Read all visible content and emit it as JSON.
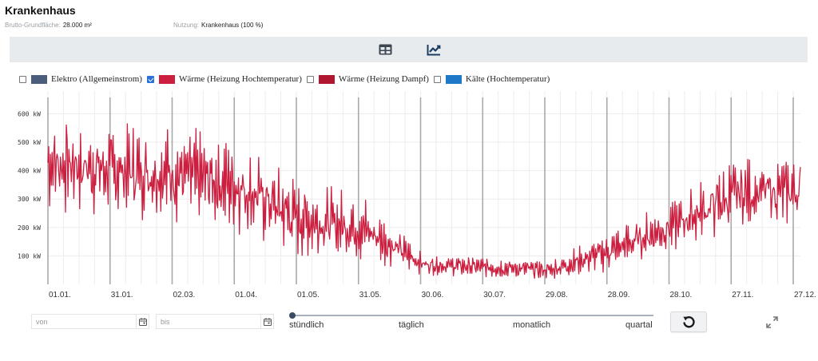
{
  "header": {
    "title": "Krankenhaus",
    "area_label": "Brutto-Grundfläche:",
    "area_value": "28.000 m²",
    "use_label": "Nutzung:",
    "use_value": "Krankenhaus (100 %)"
  },
  "toolbar": {
    "table_icon": "table-icon",
    "chart_icon": "line-chart-icon",
    "active": "chart"
  },
  "legend": [
    {
      "label": "Elektro (Allgemeinstrom)",
      "checked": false,
      "color": "#4a5e7c"
    },
    {
      "label": "Wärme (Heizung Hochtemperatur)",
      "checked": true,
      "color": "#cc1f3f"
    },
    {
      "label": "Wärme (Heizung Dampf)",
      "checked": false,
      "color": "#b0162f"
    },
    {
      "label": "Kälte (Hochtemperatur)",
      "checked": false,
      "color": "#1f78c8"
    }
  ],
  "chart_data": {
    "type": "line",
    "series": [
      {
        "name": "Wärme (Heizung Hochtemperatur)",
        "color": "#cc1f3f",
        "envelope_x": [
          "01.01.",
          "31.01.",
          "02.03.",
          "01.04.",
          "01.05.",
          "31.05.",
          "30.06.",
          "30.07.",
          "29.08.",
          "28.09.",
          "28.10.",
          "27.11.",
          "27.12."
        ],
        "mean_kW": [
          430,
          400,
          390,
          350,
          230,
          200,
          70,
          60,
          50,
          120,
          210,
          320,
          330
        ],
        "amplitude_kW": [
          150,
          140,
          140,
          140,
          110,
          100,
          30,
          30,
          30,
          60,
          80,
          110,
          100
        ]
      }
    ],
    "y_ticks": [
      "100 kW",
      "200 kW",
      "300 kW",
      "400 kW",
      "500 kW",
      "600 kW"
    ],
    "y_values": [
      100,
      200,
      300,
      400,
      500,
      600
    ],
    "ylim": [
      0,
      680
    ],
    "x_ticks": [
      "01.01.",
      "31.01.",
      "02.03.",
      "01.04.",
      "01.05.",
      "31.05.",
      "30.06.",
      "30.07.",
      "29.08.",
      "28.09.",
      "28.10.",
      "27.11.",
      "27.12."
    ],
    "grid": true
  },
  "controls": {
    "from_placeholder": "von",
    "to_placeholder": "bis",
    "calendar_icon": "calendar-icon",
    "resolution_options": [
      "stündlich",
      "täglich",
      "monatlich",
      "quartal"
    ],
    "resolution_selected": "stündlich",
    "reset_icon": "reset-icon",
    "expand_icon": "expand-icon"
  }
}
